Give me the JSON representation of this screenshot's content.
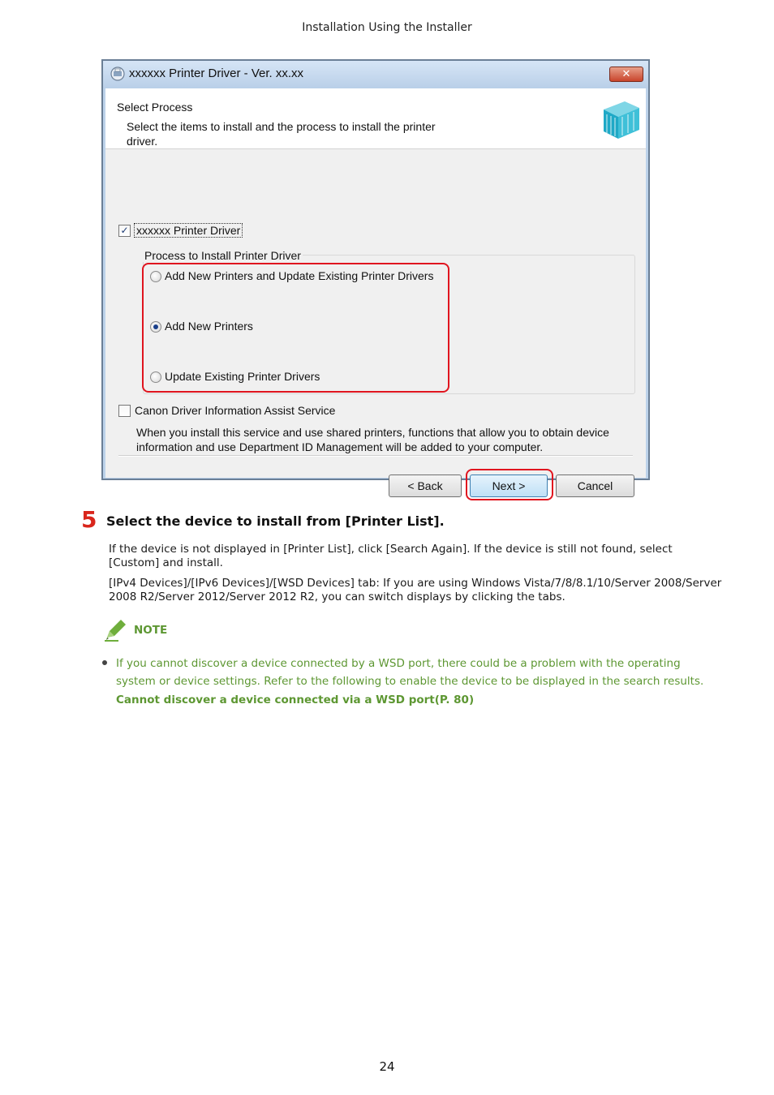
{
  "running_header": "Installation Using the Installer",
  "dialog": {
    "title": "xxxxxx Printer Driver - Ver. xx.xx",
    "close_symbol": "✕",
    "header_title": "Select Process",
    "header_subtitle": "Select the items to install and the process to install the printer driver.",
    "driver_checkbox": {
      "label": "xxxxxx Printer Driver",
      "checked": true,
      "mark": "✓"
    },
    "group_label": "Process to Install Printer Driver",
    "radio_options": [
      {
        "label": "Add New Printers and Update Existing Printer Drivers",
        "selected": false
      },
      {
        "label": "Add New Printers",
        "selected": true
      },
      {
        "label": "Update Existing Printer Drivers",
        "selected": false
      }
    ],
    "canon_checkbox": {
      "label": "Canon Driver Information Assist Service",
      "checked": false
    },
    "canon_description": "When you install this service and use shared printers, functions that allow you to obtain device information and use Department ID Management will be added to your computer.",
    "buttons": {
      "back": "< Back",
      "next": "Next >",
      "cancel": "Cancel"
    },
    "highlight_color": "#e0151f"
  },
  "step": {
    "number": "5",
    "title": "Select the device to install from [Printer List].",
    "paragraphs": [
      "If the device is not displayed in [Printer List], click [Search Again]. If the device is still not found, select [Custom] and install.",
      "[IPv4 Devices]/[IPv6 Devices]/[WSD Devices] tab: If you are using Windows Vista/7/8/8.1/10/Server 2008/Server 2008 R2/Server 2012/Server 2012 R2, you can switch displays by clicking the tabs."
    ]
  },
  "note": {
    "label": "NOTE",
    "icon": "pencil-icon",
    "text": "If you cannot discover a device connected by a WSD port, there could be a problem with the operating system or device settings. Refer to the following to enable the device to be displayed in the search results.",
    "link": "Cannot discover a device connected via a WSD port(P. 80)",
    "color": "#5d9732"
  },
  "page_number": "24"
}
